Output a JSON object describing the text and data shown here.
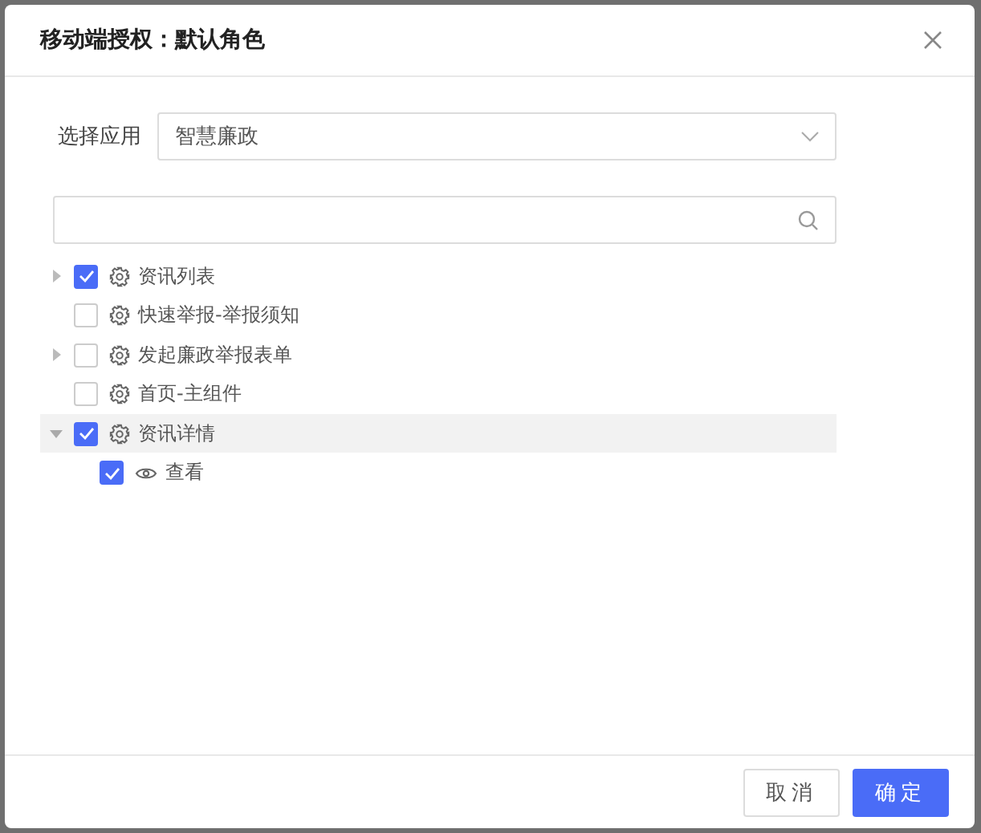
{
  "dialog": {
    "title": "移动端授权：默认角色"
  },
  "app_select": {
    "label": "选择应用",
    "value": "智慧廉政"
  },
  "tree": [
    {
      "label": "资讯列表",
      "kind": "page",
      "expanded": false,
      "checked": true,
      "selected": false
    },
    {
      "label": "快速举报-举报须知",
      "kind": "page",
      "checked": false,
      "selected": false
    },
    {
      "label": "发起廉政举报表单",
      "kind": "page",
      "expanded": false,
      "checked": false,
      "selected": false
    },
    {
      "label": "首页-主组件",
      "kind": "page",
      "checked": false,
      "selected": false
    },
    {
      "label": "资讯详情",
      "kind": "page",
      "expanded": true,
      "checked": true,
      "selected": true,
      "children": [
        {
          "label": "查看",
          "kind": "action",
          "checked": true,
          "selected": false
        }
      ]
    }
  ],
  "buttons": {
    "cancel": "取消",
    "ok": "确定"
  }
}
